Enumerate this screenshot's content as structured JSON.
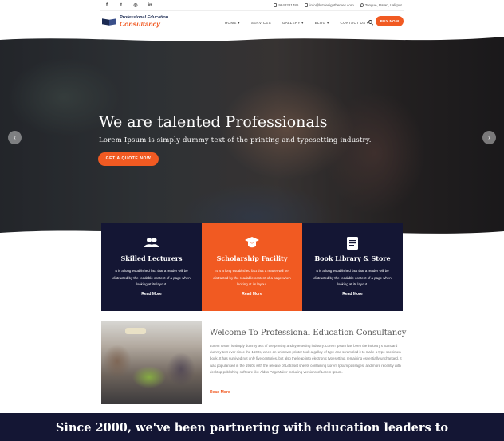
{
  "topbar": {
    "social": [
      {
        "icon": "facebook-icon",
        "glyph": "f"
      },
      {
        "icon": "twitter-icon",
        "glyph": "t"
      },
      {
        "icon": "instagram-icon",
        "glyph": "◎"
      },
      {
        "icon": "linkedin-icon",
        "glyph": "in"
      }
    ],
    "phone": "9848221486",
    "email": "info@luzdesignthemes.com",
    "location": "Tongue, Patan, Lalitpur"
  },
  "header": {
    "logo_line1": "Professional Education",
    "logo_line2": "Consultancy",
    "nav": [
      "HOME ▾",
      "SERVICES",
      "GALLERY ▾",
      "BLOG ▾",
      "CONTACT US ▾"
    ],
    "buy_label": "BUY NOW"
  },
  "hero": {
    "title": "We are talented Professionals",
    "subtitle": "Lorem Ipsum is simply dummy text of the printing and typesetting industry.",
    "cta": "GET A QUOTE NOW",
    "prev": "‹",
    "next": "›"
  },
  "features": [
    {
      "icon": "users-icon",
      "title": "Skilled Lecturers",
      "text": "It is a long established fact that a reader will be distracted by the readable content of a page when looking at its layout.",
      "more": "Read More"
    },
    {
      "icon": "graduation-cap-icon",
      "title": "Scholarship Facility",
      "text": "It is a long established fact that a reader will be distracted by the readable content of a page when looking at its layout.",
      "more": "Read More"
    },
    {
      "icon": "book-icon",
      "title": "Book Library & Store",
      "text": "It is a long established fact that a reader will be distracted by the readable content of a page when looking at its layout.",
      "more": "Read More"
    }
  ],
  "welcome": {
    "title": "Welcome To Professional Education Consultancy",
    "text": "Lorem Ipsum is simply dummy text of the printing and typesetting industry. Lorem Ipsum has been the industry's standard dummy text ever since the 1500s, when an unknown printer took a galley of type and scrambled it to make a type specimen book. It has survived not only five centuries, but also the leap into electronic typesetting, remaining essentially unchanged. It was popularised in the 1960s with the release of Letraset sheets containing Lorem Ipsum passages, and more recently with desktop publishing software like Aldus PageMaker including versions of Lorem Ipsum.",
    "more": "Read More"
  },
  "band": {
    "text": "Since 2000, we've been partnering with education leaders to"
  },
  "colors": {
    "accent": "#f15a22",
    "navy": "#141634"
  }
}
